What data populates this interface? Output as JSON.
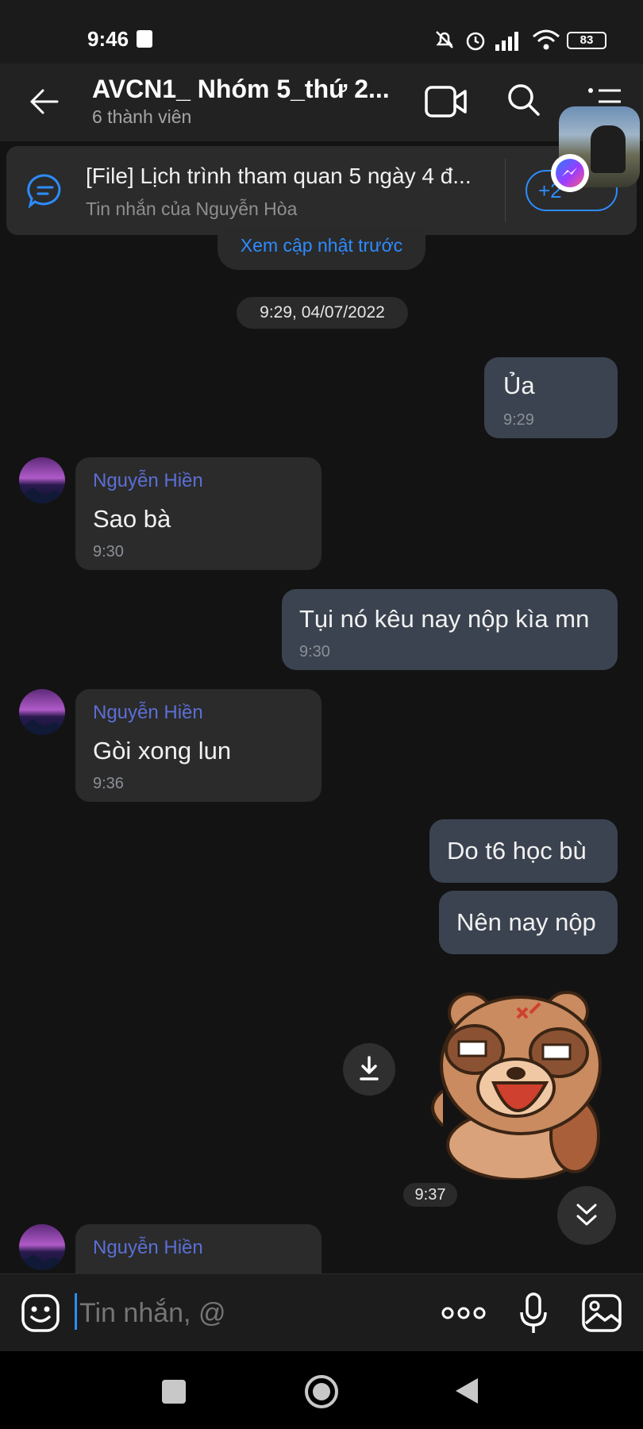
{
  "status_bar": {
    "time": "9:46",
    "battery": "83"
  },
  "header": {
    "title": "AVCN1_ Nhóm 5_thứ 2...",
    "subtitle": "6 thành viên"
  },
  "pinned": {
    "title": "[File] Lịch trình tham quan 5 ngày 4 đ...",
    "subtitle": "Tin nhắn của Nguyễn Hòa",
    "badge": "+2"
  },
  "load_previous": "Xem cập nhật trước",
  "date_divider": "9:29, 04/07/2022",
  "messages": [
    {
      "text": "Ủa",
      "time": "9:29"
    },
    {
      "sender": "Nguyễn Hiền",
      "text": "Sao bà",
      "time": "9:30"
    },
    {
      "text": "Tụi nó kêu nay nộp kìa mn",
      "time": "9:30"
    },
    {
      "sender": "Nguyễn Hiền",
      "text": "Gòi xong lun",
      "time": "9:36"
    },
    {
      "text": "Do t6 học bù"
    },
    {
      "text": "Nên nay nộp"
    },
    {
      "sticker": "angry-bear-sticker",
      "time": "9:37"
    },
    {
      "sender": "Nguyễn Hiền"
    }
  ],
  "input": {
    "placeholder": "Tin nhắn, @"
  },
  "colors": {
    "accent": "#2d8cff",
    "sender": "#5b6fd6",
    "bubble_me": "#3b4350",
    "bubble_them": "#2b2b2b"
  }
}
